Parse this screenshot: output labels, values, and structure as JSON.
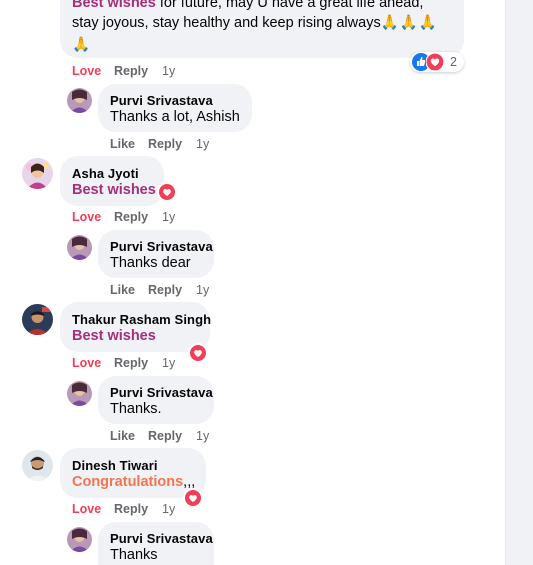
{
  "comments": [
    {
      "id": "top",
      "lead": "Best wishes",
      "line1_rest": " for future, may U have a great life ahead,",
      "line2": "stay joyous, stay healthy and keep rising always",
      "emoji": "🙏",
      "actions": {
        "love": "Love",
        "reply": "Reply",
        "time": "1y"
      },
      "reactions": {
        "count": "2",
        "icons": [
          "like-icon",
          "love-icon"
        ]
      }
    },
    {
      "id": "reply1",
      "author": "Purvi Srivastava",
      "text": "Thanks a lot, Ashish",
      "actions": {
        "like": "Like",
        "reply": "Reply",
        "time": "1y"
      }
    },
    {
      "id": "asha",
      "author": "Asha Jyoti",
      "text": "Best wishes",
      "actions": {
        "love": "Love",
        "reply": "Reply",
        "time": "1y"
      }
    },
    {
      "id": "reply2",
      "author": "Purvi Srivastava",
      "text": "Thanks dear",
      "actions": {
        "like": "Like",
        "reply": "Reply",
        "time": "1y"
      }
    },
    {
      "id": "thakur",
      "author": "Thakur Rasham Singh",
      "text": "Best wishes",
      "actions": {
        "love": "Love",
        "reply": "Reply",
        "time": "1y"
      }
    },
    {
      "id": "reply3",
      "author": "Purvi Srivastava",
      "text": "Thanks.",
      "actions": {
        "like": "Like",
        "reply": "Reply",
        "time": "1y"
      }
    },
    {
      "id": "dinesh",
      "author": "Dinesh Tiwari",
      "text": "Congratulations",
      "suffix": ",,,",
      "actions": {
        "love": "Love",
        "reply": "Reply",
        "time": "1y"
      }
    },
    {
      "id": "reply4",
      "author": "Purvi Srivastava",
      "text": "Thanks"
    }
  ],
  "colors": {
    "bubble": "#f0f2f5",
    "love": "#f33e58",
    "best_wishes": "#a3307a",
    "congratulations": "#f7734f",
    "meta": "#65676b",
    "like_blue": "#1877f2"
  }
}
